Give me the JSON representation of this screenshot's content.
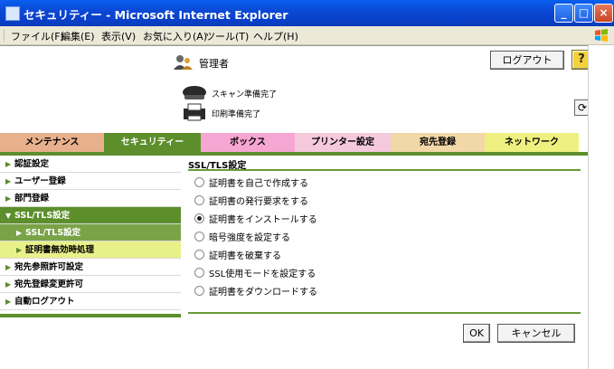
{
  "window": {
    "title": "セキュリティー - Microsoft Internet Explorer"
  },
  "menubar": {
    "items": [
      "ファイル(F)",
      "編集(E)",
      "表示(V)",
      "お気に入り(A)",
      "ツール(T)",
      "ヘルプ(H)"
    ]
  },
  "header": {
    "user": "管理者",
    "logout": "ログアウト",
    "help": "?",
    "scan_status": "スキャン準備完了",
    "print_status": "印刷準備完了"
  },
  "tabs": [
    {
      "label": "メンテナンス",
      "color": "#e8b08c"
    },
    {
      "label": "セキュリティー",
      "color": "#5c8f2c"
    },
    {
      "label": "ボックス",
      "color": "#f6a6d2"
    },
    {
      "label": "プリンター設定",
      "color": "#f5c9dc"
    },
    {
      "label": "宛先登録",
      "color": "#f2d7a8"
    },
    {
      "label": "ネットワーク",
      "color": "#eef080"
    }
  ],
  "sidebar": {
    "items": [
      {
        "label": "認証設定"
      },
      {
        "label": "ユーザー登録"
      },
      {
        "label": "部門登録"
      },
      {
        "label": "SSL/TLS設定"
      },
      {
        "label": "SSL/TLS設定"
      },
      {
        "label": "証明書無効時処理"
      },
      {
        "label": "宛先参照許可設定"
      },
      {
        "label": "宛先登録変更許可"
      },
      {
        "label": "自動ログアウト"
      }
    ]
  },
  "main": {
    "title": "SSL/TLS設定",
    "options": [
      {
        "label": "証明書を自己で作成する",
        "checked": false
      },
      {
        "label": "証明書の発行要求をする",
        "checked": false
      },
      {
        "label": "証明書をインストールする",
        "checked": true
      },
      {
        "label": "暗号強度を設定する",
        "checked": false
      },
      {
        "label": "証明書を破棄する",
        "checked": false
      },
      {
        "label": "SSL使用モードを設定する",
        "checked": false
      },
      {
        "label": "証明書をダウンロードする",
        "checked": false
      }
    ],
    "ok": "OK",
    "cancel": "キャンセル"
  },
  "colors": {
    "titlebar": "#0b49d6",
    "accent_green": "#5c8f2c",
    "menubar": "#ece9d8"
  }
}
